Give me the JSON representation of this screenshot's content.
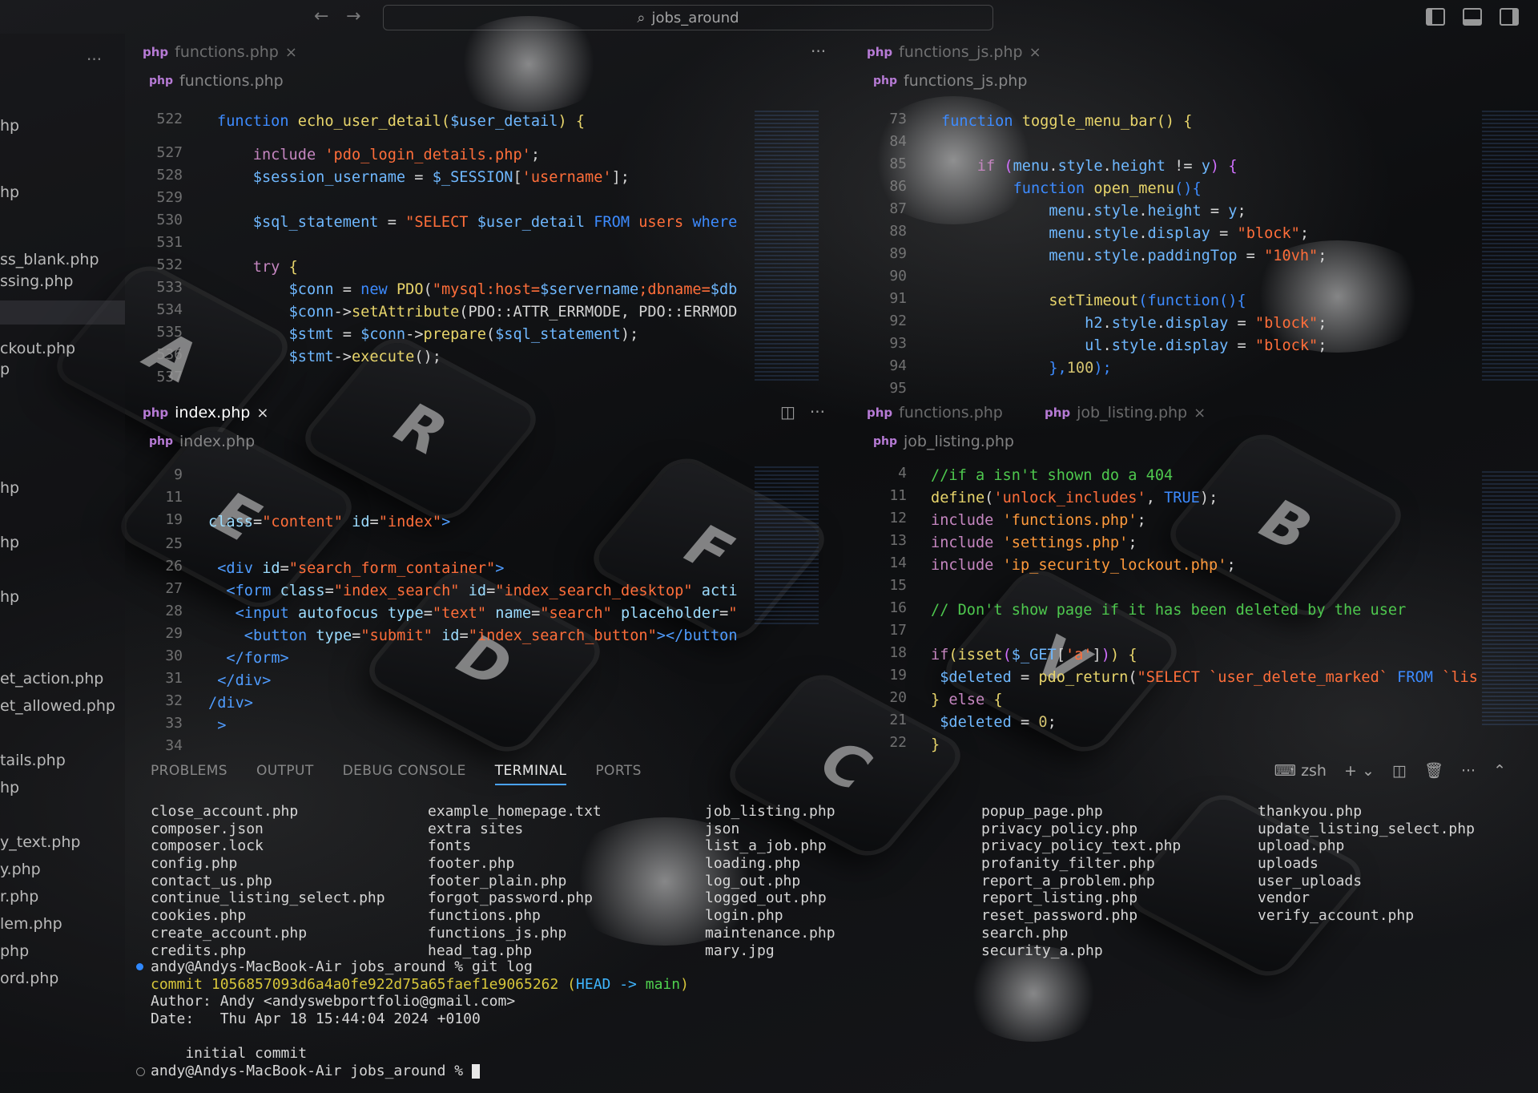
{
  "window": {
    "search_text": "jobs_around",
    "back_icon": "arrow-left-icon",
    "forward_icon": "arrow-right-icon"
  },
  "sidebar": {
    "more": "···",
    "items": [
      {
        "label": "hp"
      },
      {
        "label": "hp"
      },
      {
        "label": "ss_blank.php"
      },
      {
        "label": "ssing.php"
      },
      {
        "label": "ckout.php"
      },
      {
        "label": "p"
      },
      {
        "label": "hp"
      },
      {
        "label": "hp"
      },
      {
        "label": "hp"
      },
      {
        "label": "et_action.php"
      },
      {
        "label": "et_allowed.php"
      },
      {
        "label": "tails.php"
      },
      {
        "label": "hp"
      },
      {
        "label": "y_text.php"
      },
      {
        "label": "y.php"
      },
      {
        "label": "r.php"
      },
      {
        "label": "lem.php"
      },
      {
        "label": "php"
      },
      {
        "label": "ord.php"
      }
    ]
  },
  "panes": {
    "top_left": {
      "tab": "functions.php",
      "breadcrumb": "functions.php",
      "line_numbers": [
        "522",
        "527",
        "528",
        "529",
        "530",
        "531",
        "532",
        "533",
        "534",
        "535",
        "536",
        "537"
      ]
    },
    "top_right": {
      "tab": "functions_js.php",
      "breadcrumb": "functions_js.php",
      "line_numbers": [
        "73",
        "84",
        "85",
        "86",
        "87",
        "88",
        "89",
        "90",
        "91",
        "92",
        "93",
        "94",
        "95"
      ]
    },
    "bottom_left": {
      "tab": "index.php",
      "breadcrumb": "index.php",
      "line_numbers": [
        "9",
        "11",
        "19",
        "25",
        "26",
        "27",
        "28",
        "29",
        "30",
        "31",
        "32",
        "33",
        "34"
      ]
    },
    "bottom_right": {
      "tab_inactive": "functions.php",
      "tab": "job_listing.php",
      "breadcrumb": "job_listing.php",
      "line_numbers": [
        "4",
        "11",
        "12",
        "13",
        "14",
        "15",
        "16",
        "17",
        "18",
        "19",
        "20",
        "21",
        "22"
      ]
    }
  },
  "panel": {
    "tabs": [
      "PROBLEMS",
      "OUTPUT",
      "DEBUG CONSOLE",
      "TERMINAL",
      "PORTS"
    ],
    "active_tab": "TERMINAL",
    "shell": "zsh",
    "columns": [
      [
        "close_account.php",
        "composer.json",
        "composer.lock",
        "config.php",
        "contact_us.php",
        "continue_listing_select.php",
        "cookies.php",
        "create_account.php",
        "credits.php"
      ],
      [
        "example_homepage.txt",
        "extra sites",
        "fonts",
        "footer.php",
        "footer_plain.php",
        "forgot_password.php",
        "functions.php",
        "functions_js.php",
        "head_tag.php"
      ],
      [
        "job_listing.php",
        "json",
        "list_a_job.php",
        "loading.php",
        "log_out.php",
        "logged_out.php",
        "login.php",
        "maintenance.php",
        "mary.jpg"
      ],
      [
        "popup_page.php",
        "privacy_policy.php",
        "privacy_policy_text.php",
        "profanity_filter.php",
        "report_a_problem.php",
        "report_listing.php",
        "reset_password.php",
        "search.php",
        "security_a.php"
      ],
      [
        "thankyou.php",
        "update_listing_select.php",
        "upload.php",
        "uploads",
        "user_uploads",
        "vendor",
        "verify_account.php"
      ]
    ],
    "prompt_git": "andy@Andys-MacBook-Air jobs_around % git log",
    "commit_hash": "commit 1056857093d6a4a0fe922d75a65faef1e9065262",
    "commit_ref_open": " (",
    "commit_head": "HEAD -> ",
    "commit_branch": "main",
    "commit_ref_close": ")",
    "author": "Author: Andy <andyswebportfolio@gmail.com>",
    "date": "Date:   Thu Apr 18 15:44:04 2024 +0100",
    "message": "    initial commit",
    "prompt_end": "andy@Andys-MacBook-Air jobs_around % "
  },
  "colors": {
    "accent": "#4aa3ff",
    "php_icon": "#b77bd6",
    "git_dot_active": "#2f88ff"
  }
}
